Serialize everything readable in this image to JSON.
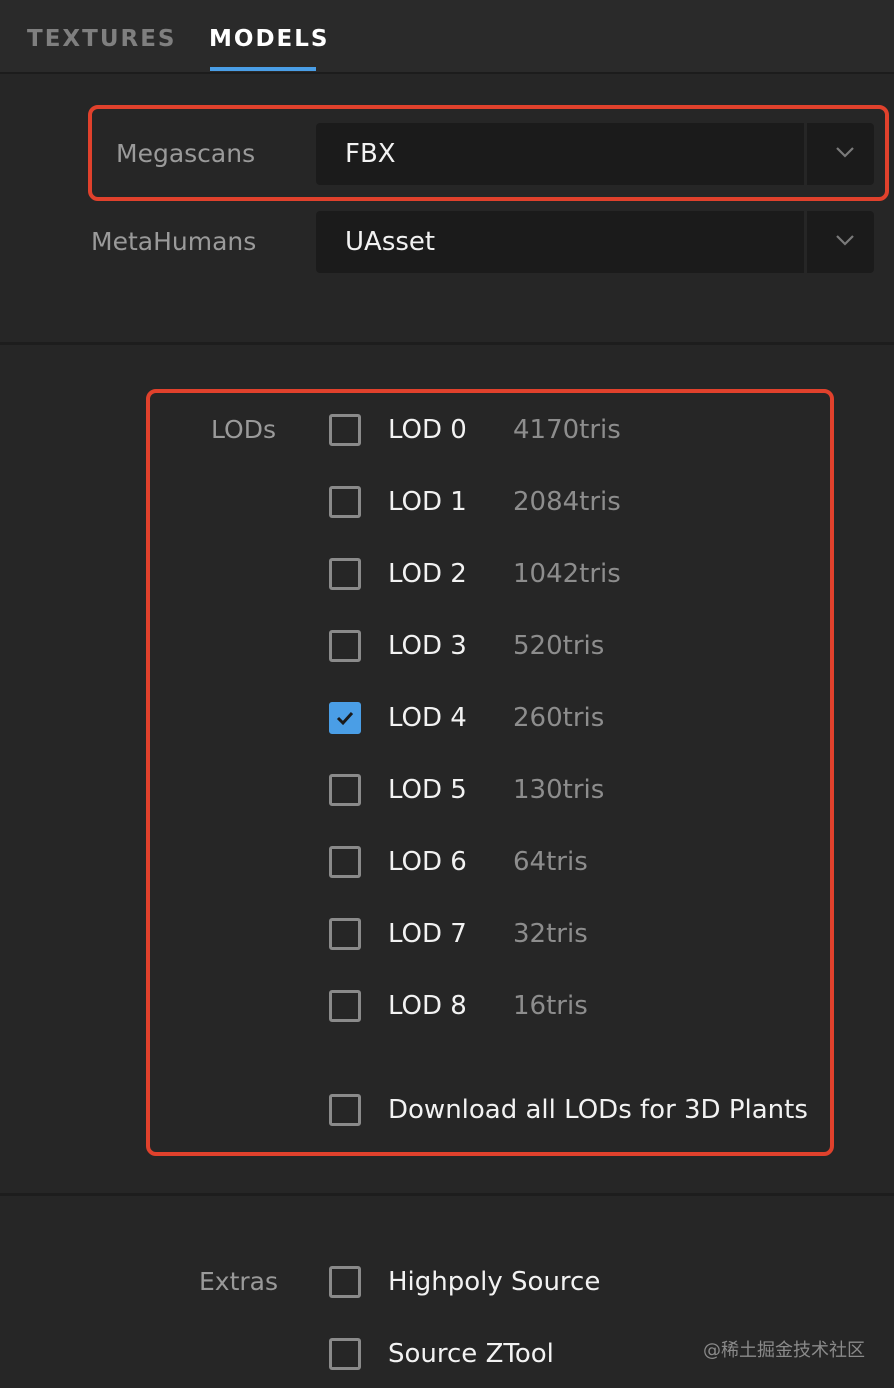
{
  "tabs": [
    {
      "label": "TEXTURES",
      "active": false
    },
    {
      "label": "MODELS",
      "active": true
    }
  ],
  "format_rows": [
    {
      "label": "Megascans",
      "value": "FBX"
    },
    {
      "label": "MetaHumans",
      "value": "UAsset"
    }
  ],
  "lods": {
    "label": "LODs",
    "items": [
      {
        "name": "LOD 0",
        "tris": "4170tris",
        "checked": false
      },
      {
        "name": "LOD 1",
        "tris": "2084tris",
        "checked": false
      },
      {
        "name": "LOD 2",
        "tris": "1042tris",
        "checked": false
      },
      {
        "name": "LOD 3",
        "tris": "520tris",
        "checked": false
      },
      {
        "name": "LOD 4",
        "tris": "260tris",
        "checked": true
      },
      {
        "name": "LOD 5",
        "tris": "130tris",
        "checked": false
      },
      {
        "name": "LOD 6",
        "tris": "64tris",
        "checked": false
      },
      {
        "name": "LOD 7",
        "tris": "32tris",
        "checked": false
      },
      {
        "name": "LOD 8",
        "tris": "16tris",
        "checked": false
      }
    ],
    "download_all_label": "Download all LODs for 3D Plants",
    "download_all_checked": false
  },
  "extras": {
    "label": "Extras",
    "items": [
      {
        "label": "Highpoly Source",
        "checked": false
      },
      {
        "label": "Source ZTool",
        "checked": false
      }
    ]
  },
  "watermark": "@稀土掘金技术社区",
  "colors": {
    "accent": "#4a9ee6",
    "highlight": "#e0412c",
    "background": "#262626"
  }
}
